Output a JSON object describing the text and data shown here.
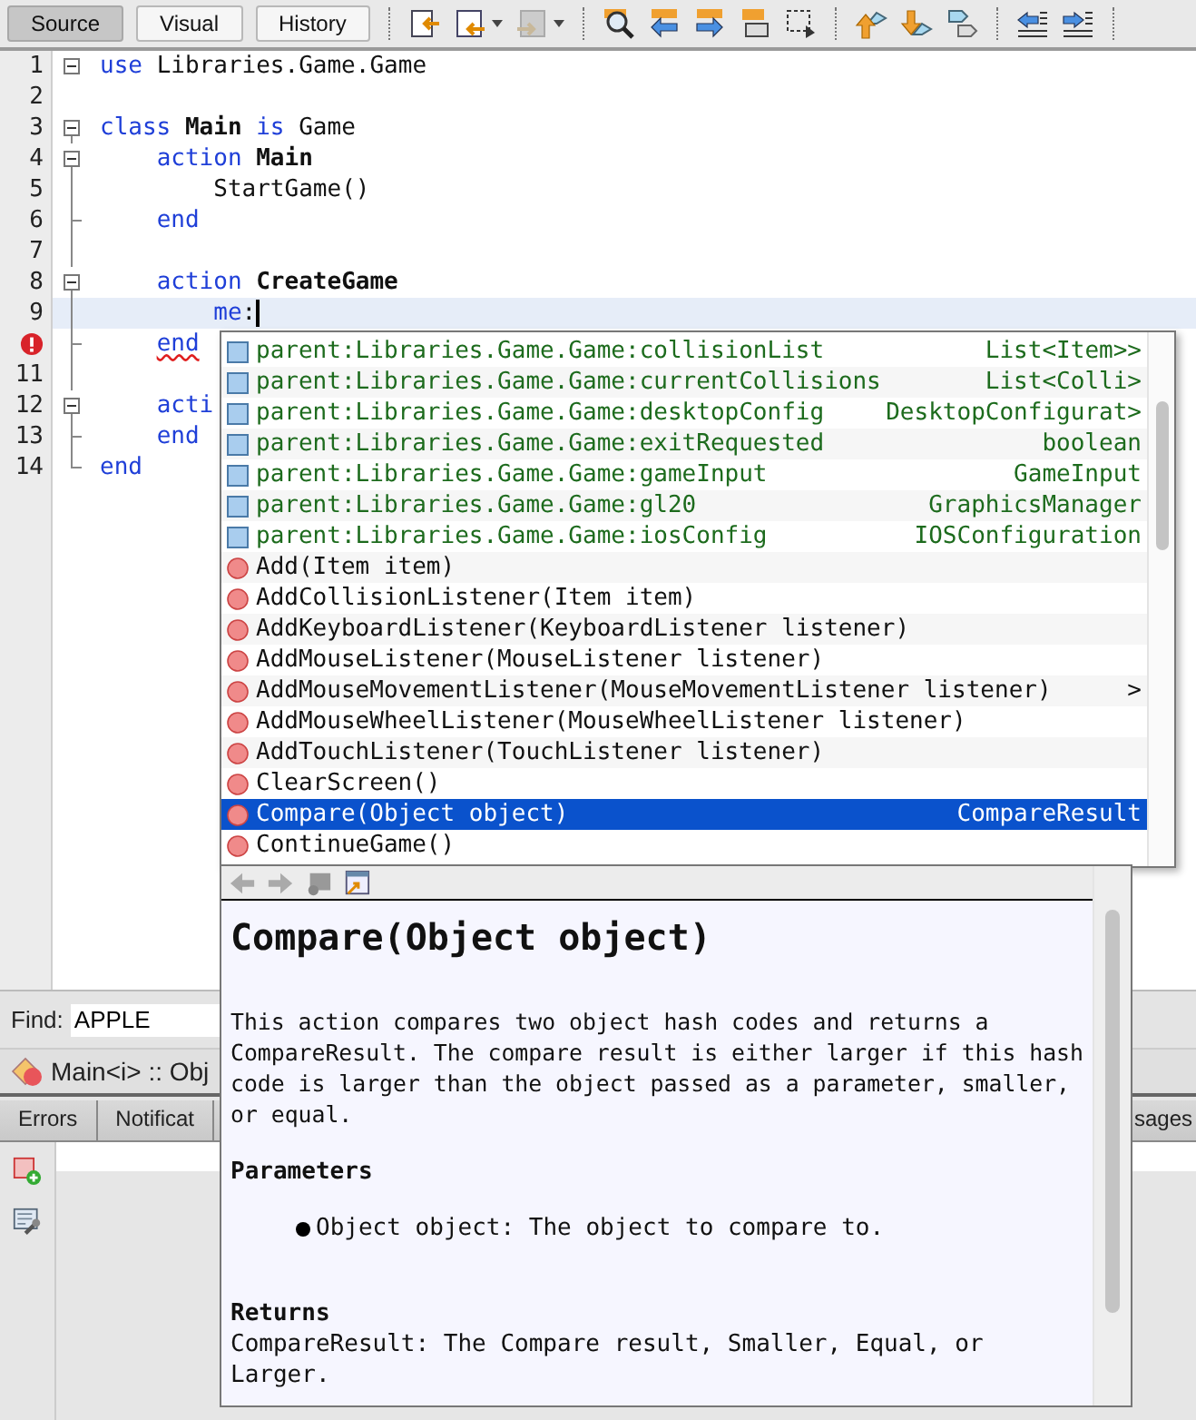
{
  "toolbar": {
    "views": [
      {
        "label": "Source",
        "selected": true
      },
      {
        "label": "Visual",
        "selected": false
      },
      {
        "label": "History",
        "selected": false
      }
    ]
  },
  "editor": {
    "lines": [
      {
        "number": "1",
        "fold_start": true,
        "tokens": [
          {
            "kind": "keyword",
            "text": "use"
          },
          {
            "kind": "plain",
            "text": " Libraries.Game.Game"
          }
        ]
      },
      {
        "number": "2"
      },
      {
        "number": "3",
        "fold_start": true,
        "tokens": [
          {
            "kind": "keyword",
            "text": "class"
          },
          {
            "kind": "bold",
            "text": " Main"
          },
          {
            "kind": "keyword",
            "text": " is"
          },
          {
            "kind": "plain",
            "text": " Game"
          }
        ]
      },
      {
        "number": "4",
        "fold_start": true,
        "tokens": [
          {
            "kind": "keyword",
            "text": "    action"
          },
          {
            "kind": "bold",
            "text": " Main"
          }
        ]
      },
      {
        "number": "5",
        "fold_guide": true,
        "tokens": [
          {
            "kind": "plain",
            "text": "        StartGame()"
          }
        ]
      },
      {
        "number": "6",
        "fold_end": true,
        "tokens": [
          {
            "kind": "keyword",
            "text": "    end"
          }
        ]
      },
      {
        "number": "7",
        "fold_guide": true
      },
      {
        "number": "8",
        "fold_start": true,
        "tokens": [
          {
            "kind": "keyword",
            "text": "    action"
          },
          {
            "kind": "bold",
            "text": " CreateGame"
          }
        ]
      },
      {
        "number": "9",
        "fold_guide": true,
        "current": true,
        "caret": true,
        "tokens": [
          {
            "kind": "keyword",
            "text": "        me"
          },
          {
            "kind": "plain",
            "text": ":"
          }
        ]
      },
      {
        "error": true,
        "fold_end": true,
        "tokens": [
          {
            "kind": "error",
            "text": "    end"
          }
        ]
      },
      {
        "number": "11",
        "fold_guide": true
      },
      {
        "number": "12",
        "fold_start": true,
        "tokens": [
          {
            "kind": "keyword",
            "text": "    acti"
          }
        ]
      },
      {
        "number": "13",
        "fold_end": true,
        "tokens": [
          {
            "kind": "keyword",
            "text": "    end"
          }
        ]
      },
      {
        "number": "14",
        "fold_end": true,
        "tokens": [
          {
            "kind": "keyword",
            "text": "end"
          }
        ]
      }
    ]
  },
  "completion": {
    "items": [
      {
        "kind": "field",
        "name": "parent:Libraries.Game.Game:collisionList",
        "type": "List<Item>>",
        "selected": false
      },
      {
        "kind": "field",
        "name": "parent:Libraries.Game.Game:currentCollisions",
        "type": "List<Colli>",
        "selected": false
      },
      {
        "kind": "field",
        "name": "parent:Libraries.Game.Game:desktopConfig",
        "type": "DesktopConfigurat>",
        "selected": false
      },
      {
        "kind": "field",
        "name": "parent:Libraries.Game.Game:exitRequested",
        "type": "boolean",
        "selected": false
      },
      {
        "kind": "field",
        "name": "parent:Libraries.Game.Game:gameInput",
        "type": "GameInput",
        "selected": false
      },
      {
        "kind": "field",
        "name": "parent:Libraries.Game.Game:gl20",
        "type": "GraphicsManager",
        "selected": false
      },
      {
        "kind": "field",
        "name": "parent:Libraries.Game.Game:iosConfig",
        "type": "IOSConfiguration",
        "selected": false
      },
      {
        "kind": "method",
        "name": "Add(Item item)",
        "selected": false
      },
      {
        "kind": "method",
        "name": "AddCollisionListener(Item item)",
        "selected": false
      },
      {
        "kind": "method",
        "name": "AddKeyboardListener(KeyboardListener listener)",
        "selected": false
      },
      {
        "kind": "method",
        "name": "AddMouseListener(MouseListener listener)",
        "selected": false
      },
      {
        "kind": "method",
        "name": "AddMouseMovementListener(MouseMovementListener listener)",
        "type": ">",
        "selected": false
      },
      {
        "kind": "method",
        "name": "AddMouseWheelListener(MouseWheelListener listener)",
        "selected": false
      },
      {
        "kind": "method",
        "name": "AddTouchListener(TouchListener listener)",
        "selected": false
      },
      {
        "kind": "method",
        "name": "ClearScreen()",
        "selected": false
      },
      {
        "kind": "method",
        "name": "Compare(Object object)",
        "type": "CompareResult",
        "selected": true
      },
      {
        "kind": "method",
        "name": "ContinueGame()",
        "selected": false
      }
    ]
  },
  "documentation": {
    "title": "Compare(Object object)",
    "description": "This action compares two object hash codes and returns a CompareResult. The compare result is either larger if this hash code is larger than the object passed as a parameter, smaller, or equal.",
    "parameters_heading": "Parameters",
    "parameters": [
      "Object object: The object to compare to."
    ],
    "returns_heading": "Returns",
    "returns": "CompareResult: The Compare result, Smaller, Equal, or Larger."
  },
  "find_bar": {
    "label": "Find:",
    "value": "APPLE"
  },
  "navigator": {
    "path": "Main<i> :: Obj"
  },
  "output_tabs": [
    {
      "label": "Errors",
      "selected": false
    },
    {
      "label": "Notificat",
      "selected": false
    },
    {
      "label": "sages",
      "selected": false
    }
  ]
}
